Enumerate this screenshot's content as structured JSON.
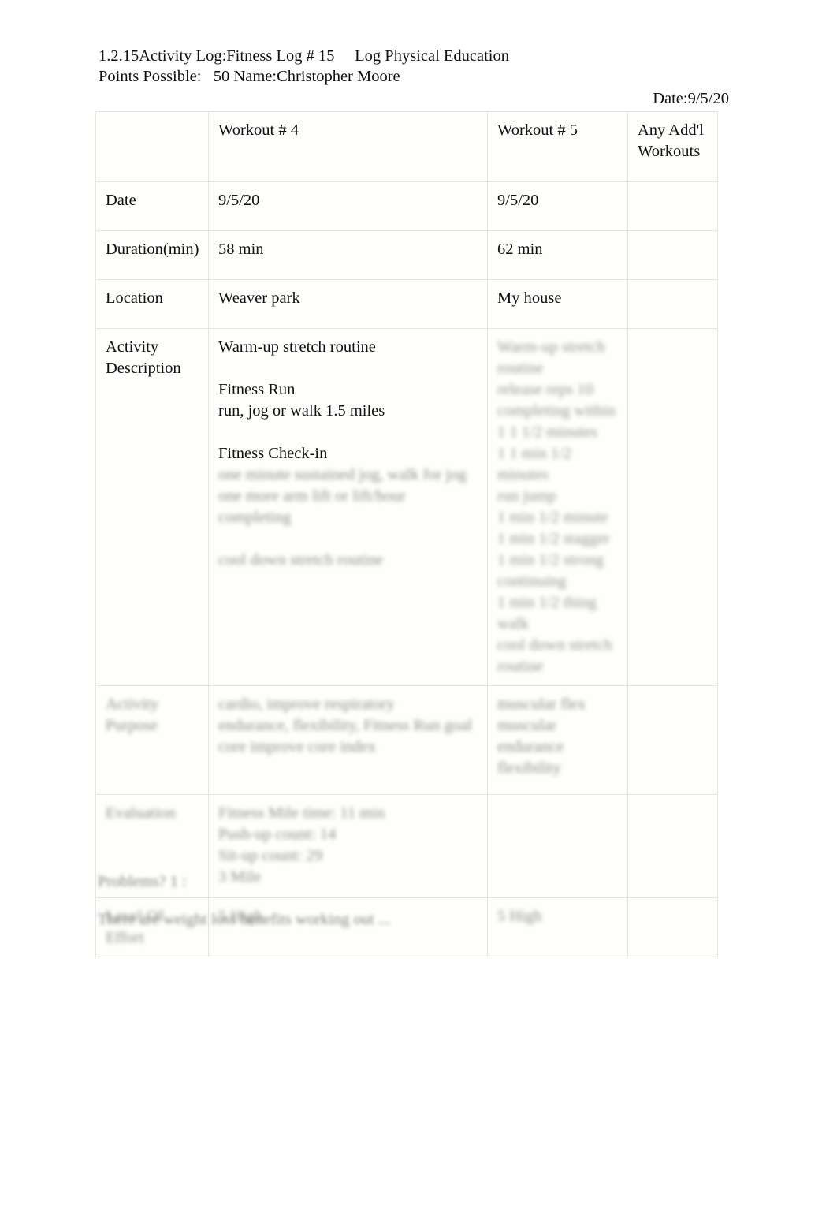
{
  "document": {
    "header": {
      "line1": "1.2.15Activity Log:Fitness Log # 15     Log Physical Education",
      "line2": "Points Possible:   50 Name:Christopher Moore",
      "date_line": "Date:9/5/20"
    },
    "table": {
      "columns": [
        {
          "key": "label",
          "header": ""
        },
        {
          "key": "workout4",
          "header": "Workout # 4"
        },
        {
          "key": "workout5",
          "header": "Workout # 5"
        },
        {
          "key": "extra",
          "header": "Any Add'l Workouts"
        }
      ],
      "rows": [
        {
          "label": "Date",
          "label_redacted": false,
          "workout4": [
            "9/5/20"
          ],
          "workout4_redacted": false,
          "workout5": [
            "9/5/20"
          ],
          "workout5_redacted": false,
          "extra": []
        },
        {
          "label": "Duration(min)",
          "label_redacted": false,
          "workout4": [
            "58 min"
          ],
          "workout4_redacted": false,
          "workout5": [
            "62 min"
          ],
          "workout5_redacted": false,
          "extra": []
        },
        {
          "label": "Location",
          "label_redacted": false,
          "workout4": [
            " Weaver park"
          ],
          "workout4_redacted": false,
          "workout5": [
            "My house"
          ],
          "workout5_redacted": false,
          "extra": []
        },
        {
          "label": "Activity Description",
          "label_redacted": false,
          "workout4": [
            "Warm-up stretch routine",
            "",
            "Fitness Run",
            "run, jog or walk 1.5 miles",
            "",
            "Fitness Check-in"
          ],
          "workout4_redacted": false,
          "workout4_extra_redacted": [
            "one minute sustained jog, walk for jog",
            "one more arm lift or lift/hour completing",
            "",
            "cool down stretch routine"
          ],
          "workout5": [
            "Warm-up stretch",
            "routine",
            "release reps 10",
            "completing within",
            "1 1 1/2 minutes",
            "1 1 min 1/2 minutes",
            "run jump",
            "1 min 1/2 minute",
            "1 min 1/2 stagger",
            "1 min 1/2 strong",
            "continuing",
            "1 min 1/2 thing",
            "walk",
            "cool down stretch",
            "routine"
          ],
          "workout5_redacted": true,
          "extra": []
        },
        {
          "label": "Activity Purpose",
          "label_redacted": true,
          "workout4": [
            "cardio, improve respiratory",
            "endurance, flexibility, Fitness Run goal",
            "core improve core index"
          ],
          "workout4_redacted": true,
          "workout5": [
            "muscular flex",
            "muscular",
            "endurance",
            "flexibility"
          ],
          "workout5_redacted": true,
          "extra": []
        },
        {
          "label": "Evaluation",
          "label_redacted": true,
          "workout4": [
            "Fitness Mile time: 11 min",
            "Push-up count: 14",
            "Sit-up count: 29",
            "3 Mile"
          ],
          "workout4_redacted": true,
          "workout5": [],
          "workout5_redacted": true,
          "extra": []
        },
        {
          "label": "Level Of Effort",
          "label_redacted": true,
          "workout4": [
            "5 High"
          ],
          "workout4_redacted": true,
          "workout5": [
            "5 High"
          ],
          "workout5_redacted": true,
          "extra": []
        }
      ]
    },
    "footer": {
      "line1": "Problems? 1 :",
      "line2": "There are weight loss benefits working out ...",
      "line1_redacted": true,
      "line2_redacted": true
    }
  }
}
